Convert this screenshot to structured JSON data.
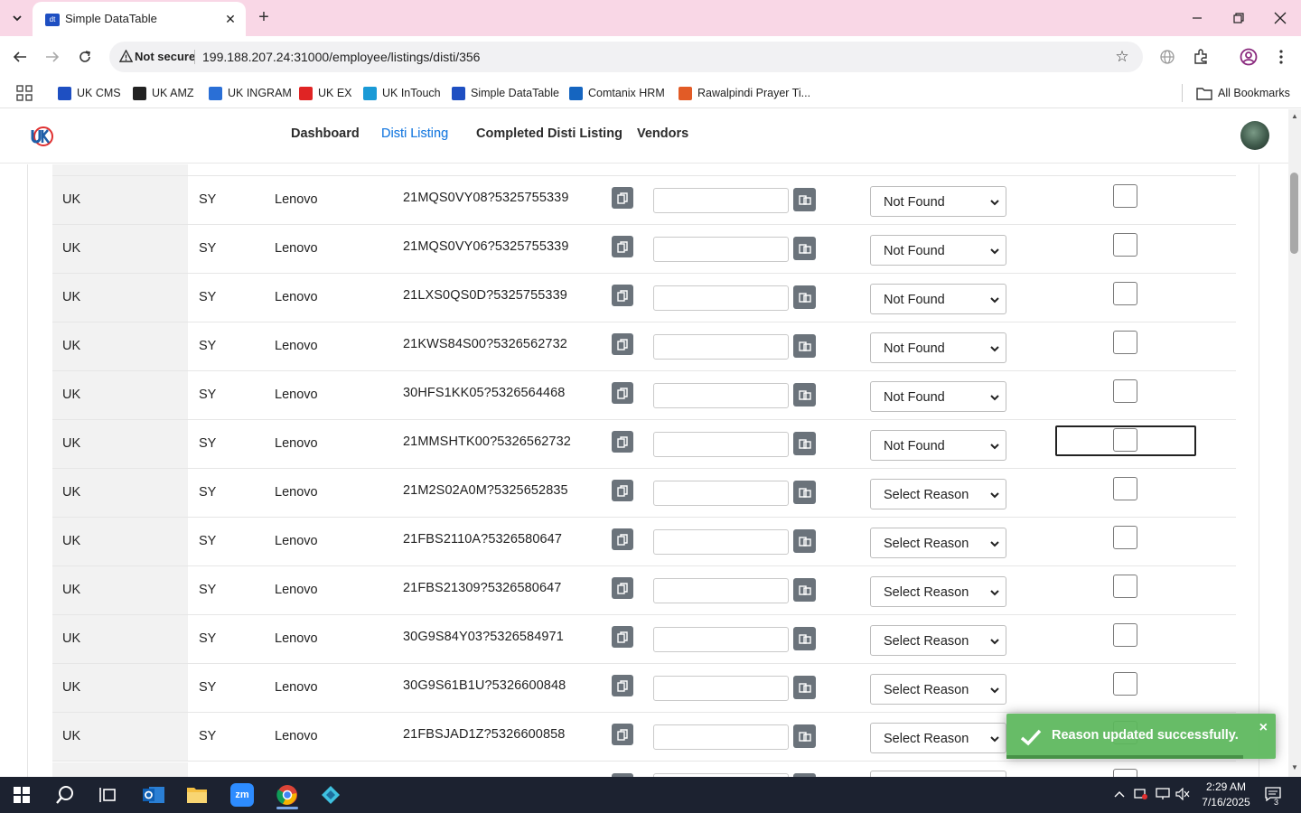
{
  "browser": {
    "tab_title": "Simple DataTable",
    "tab_favicon_text": "dt",
    "not_secure_label": "Not secure",
    "url": "199.188.207.24:31000/employee/listings/disti/356",
    "bookmarks": [
      {
        "label": "UK CMS",
        "icon_color": "#1e4fc2"
      },
      {
        "label": "UK AMZ",
        "icon_color": "#222222"
      },
      {
        "label": "UK INGRAM",
        "icon_color": "#2a6fd6"
      },
      {
        "label": "UK EX",
        "icon_color": "#e02424"
      },
      {
        "label": "UK InTouch",
        "icon_color": "#1a9ad6"
      },
      {
        "label": "Simple DataTable",
        "icon_color": "#1e4fc2"
      },
      {
        "label": "Comtanix HRM",
        "icon_color": "#1565c0"
      },
      {
        "label": "Rawalpindi Prayer Ti...",
        "icon_color": "#e25b26"
      }
    ],
    "all_bookmarks_label": "All Bookmarks"
  },
  "nav": {
    "items": [
      {
        "label": "Dashboard",
        "active": false
      },
      {
        "label": "Disti Listing",
        "active": true
      },
      {
        "label": "Completed Disti Listing",
        "active": false
      },
      {
        "label": "Vendors",
        "active": false
      }
    ]
  },
  "table": {
    "rows": [
      {
        "country": "UK",
        "code": "SY",
        "brand": "Lenovo",
        "sku": "21MQS0VY08?5325755339",
        "input": "",
        "reason": "Not Found",
        "checked": false
      },
      {
        "country": "UK",
        "code": "SY",
        "brand": "Lenovo",
        "sku": "21MQS0VY06?5325755339",
        "input": "",
        "reason": "Not Found",
        "checked": false
      },
      {
        "country": "UK",
        "code": "SY",
        "brand": "Lenovo",
        "sku": "21LXS0QS0D?5325755339",
        "input": "",
        "reason": "Not Found",
        "checked": false
      },
      {
        "country": "UK",
        "code": "SY",
        "brand": "Lenovo",
        "sku": "21KWS84S00?5326562732",
        "input": "",
        "reason": "Not Found",
        "checked": false
      },
      {
        "country": "UK",
        "code": "SY",
        "brand": "Lenovo",
        "sku": "30HFS1KK05?5326564468",
        "input": "",
        "reason": "Not Found",
        "checked": false
      },
      {
        "country": "UK",
        "code": "SY",
        "brand": "Lenovo",
        "sku": "21MMSHTK00?5326562732",
        "input": "",
        "reason": "Not Found",
        "checked": false,
        "focused": true
      },
      {
        "country": "UK",
        "code": "SY",
        "brand": "Lenovo",
        "sku": "21M2S02A0M?5325652835",
        "input": "",
        "reason": "Select Reason",
        "checked": false
      },
      {
        "country": "UK",
        "code": "SY",
        "brand": "Lenovo",
        "sku": "21FBS2110A?5326580647",
        "input": "",
        "reason": "Select Reason",
        "checked": false
      },
      {
        "country": "UK",
        "code": "SY",
        "brand": "Lenovo",
        "sku": "21FBS21309?5326580647",
        "input": "",
        "reason": "Select Reason",
        "checked": false
      },
      {
        "country": "UK",
        "code": "SY",
        "brand": "Lenovo",
        "sku": "30G9S84Y03?5326584971",
        "input": "",
        "reason": "Select Reason",
        "checked": false
      },
      {
        "country": "UK",
        "code": "SY",
        "brand": "Lenovo",
        "sku": "30G9S61B1U?5326600848",
        "input": "",
        "reason": "Select Reason",
        "checked": false
      },
      {
        "country": "UK",
        "code": "SY",
        "brand": "Lenovo",
        "sku": "21FBSJAD1Z?5326600858",
        "input": "",
        "reason": "Select Reason",
        "checked": false
      }
    ]
  },
  "toast": {
    "message": "Reason updated successfully.",
    "close_label": "×",
    "color": "#5cb85c"
  },
  "taskbar": {
    "time": "2:29 AM",
    "date": "7/16/2025",
    "notification_count": "3",
    "zoom_label": "zm"
  },
  "colors": {
    "accent": "#1f7de0",
    "tabstrip": "#f9d7e6",
    "button_gray": "#6b737b"
  }
}
